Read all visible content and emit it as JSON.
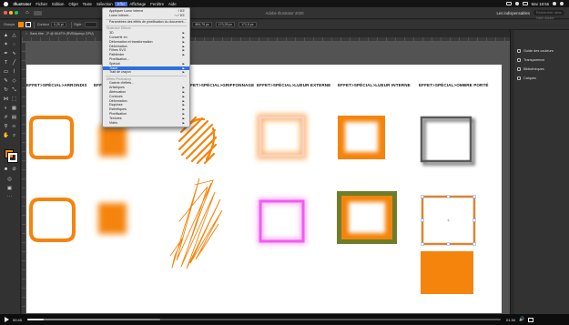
{
  "menubar": {
    "items": [
      "Illustrator",
      "Fichier",
      "Edition",
      "Objet",
      "Texte",
      "Sélection",
      "Effet",
      "Affichage",
      "Fenêtre",
      "Aide"
    ],
    "active_index": 6,
    "status": "Mar 18:56"
  },
  "appbar": {
    "title": "Adobe Illustrator 2020",
    "workspace": "Les indispensables",
    "search_placeholder": "Rechercher dans l'aide Adobe"
  },
  "control": {
    "selection_label": "Groupe",
    "stroke_label": "Contour",
    "stroke_value": "0,25 pt",
    "style_label": "Style :",
    "width_label": "Largeur",
    "width_value": "290,24 px",
    "height_value": "292,4 px",
    "x_value": "658,82 px",
    "y_value": "684,75 px",
    "w_value": "170,25 px",
    "h_value": "171,5 px"
  },
  "document_tab": "Sans titre - 2* @ 66,67% (RVB/Aperçu GPU)",
  "effects": [
    "EFFET>SPÉCIAL>ARRONDIS",
    "EFFET>SPÉCIAL>FLOU",
    "EFFET>SPÉCIAL>GRIFFONNAGE",
    "EFFET>SPÉCIAL>LUEUR EXTERNE",
    "EFFET>SPÉCIAL>LUEUR INTERNE",
    "EFFET>SPÉCIAL>OMBRE PORTÉ"
  ],
  "menu": {
    "items": [
      {
        "label": "Appliquer Lueur interne",
        "shortcut": "⇧⌘E"
      },
      {
        "label": "Lueur interne...",
        "shortcut": "⌥⇧⌘E"
      },
      {
        "divider": true
      },
      {
        "label": "Paramètres des effets de pixellisation du document...",
        "shortcut": ""
      },
      {
        "divider": true
      },
      {
        "label": "Illustrator Effects",
        "header": true
      },
      {
        "label": "3D",
        "arrow": true
      },
      {
        "label": "Convertir en",
        "arrow": true
      },
      {
        "label": "Déformation et transformation",
        "arrow": true
      },
      {
        "label": "Déformation",
        "arrow": true
      },
      {
        "label": "Filtres SVG",
        "arrow": true
      },
      {
        "label": "Pathfinder",
        "arrow": true
      },
      {
        "label": "Pixellisation...",
        "arrow": false
      },
      {
        "label": "Spécial",
        "arrow": true
      },
      {
        "label": "Tracé",
        "arrow": true,
        "highlight": true
      },
      {
        "label": "Trait de crayon",
        "arrow": true
      },
      {
        "divider": true
      },
      {
        "label": "Effets Photoshop",
        "header": true
      },
      {
        "label": "Galerie d'effets...",
        "arrow": false
      },
      {
        "label": "Artistiques",
        "arrow": true
      },
      {
        "label": "Atténuation",
        "arrow": true
      },
      {
        "label": "Contours",
        "arrow": true
      },
      {
        "label": "Déformation",
        "arrow": true
      },
      {
        "label": "Esquisse",
        "arrow": true
      },
      {
        "label": "Esthétiques",
        "arrow": true
      },
      {
        "label": "Pixellisation",
        "arrow": true
      },
      {
        "label": "Textures",
        "arrow": true
      },
      {
        "label": "Vidéo",
        "arrow": true
      }
    ]
  },
  "panels": [
    "Guide des couleurs",
    "Transparence",
    "Bibliothèques",
    "Calques"
  ],
  "video": {
    "current": "00:45",
    "duration": "01:34",
    "progress": 0.035,
    "buffered": 0.28
  },
  "colors": {
    "orange": "#f5840c",
    "pink": "#f25cf0",
    "olive": "#6e7d2a",
    "gray_shadow": "#8a8a8a",
    "menu_highlight": "#2f6fe0"
  }
}
